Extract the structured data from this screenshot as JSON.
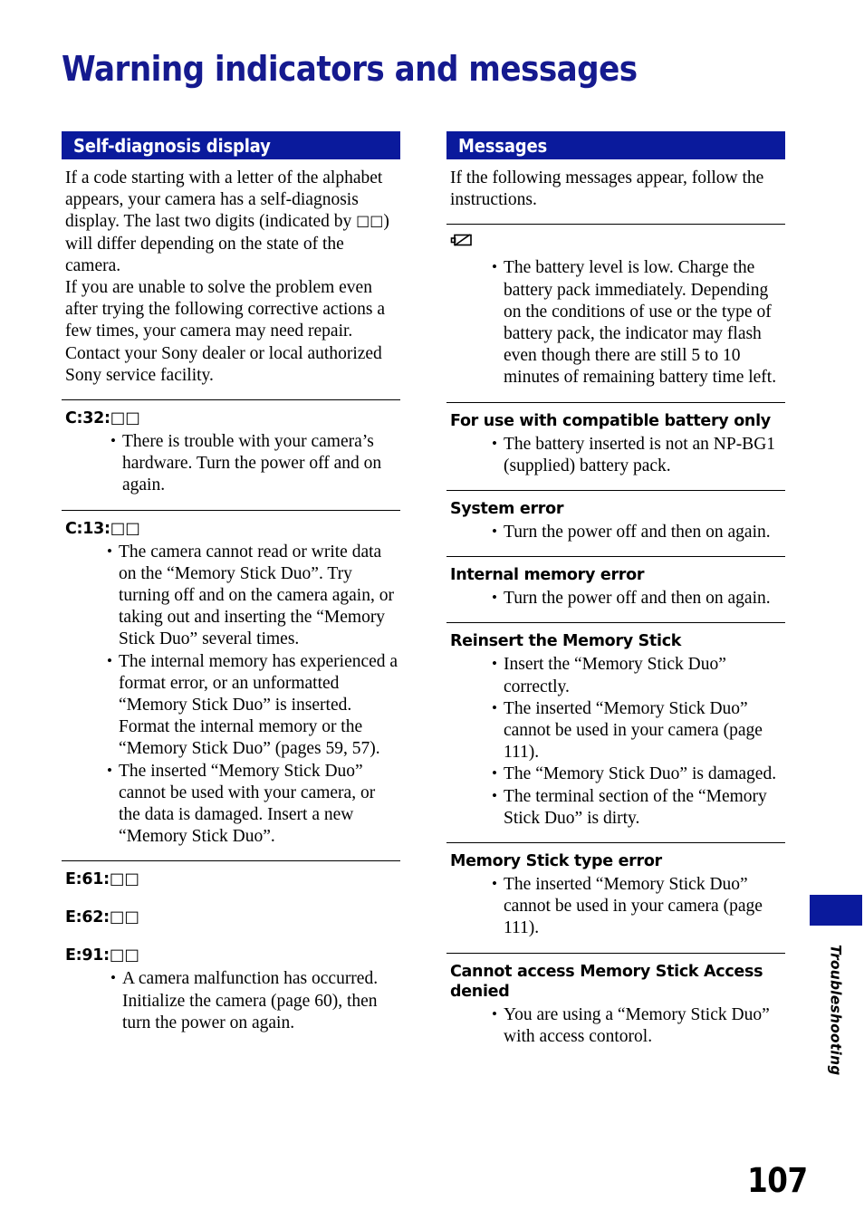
{
  "document": {
    "title": "Warning indicators and messages",
    "page_number": "107",
    "margin_tab_label": "Troubleshooting",
    "accent_color": "#0a1a9c",
    "title_color": "#151a8f"
  },
  "left_column": {
    "section_title": "Self-diagnosis display",
    "intro_paragraph_1_part1": "If a code starting with a letter of the alphabet appears, your camera has a self-diagnosis display. The last two digits (indicated by ",
    "intro_boxes": "□□",
    "intro_paragraph_1_part2": ") will differ depending on the state of the camera.",
    "intro_paragraph_2": "If you are unable to solve the problem even after trying the following corrective actions a few times, your camera may need repair. Contact your Sony dealer or local authorized Sony service facility.",
    "entries": [
      {
        "code": "C:32:",
        "boxes": "□□",
        "bullets": [
          "There is trouble with your camera’s hardware. Turn the power off and on again."
        ]
      },
      {
        "code": "C:13:",
        "boxes": "□□",
        "bullets": [
          "The camera cannot read or write data on the “Memory Stick Duo”. Try turning off and on the camera again, or taking out and inserting the “Memory Stick Duo” several times.",
          "The internal memory has experienced a format error, or an unformatted “Memory Stick Duo” is inserted. Format the internal memory or the “Memory Stick Duo” (pages 59, 57).",
          "The inserted “Memory Stick Duo” cannot be used with your camera, or the data is damaged. Insert a new “Memory Stick Duo”."
        ]
      },
      {
        "code": "E:61:",
        "boxes": "□□",
        "bullets": []
      },
      {
        "code": "E:62:",
        "boxes": "□□",
        "bullets": []
      },
      {
        "code": "E:91:",
        "boxes": "□□",
        "bullets": [
          "A camera malfunction has occurred. Initialize the camera (page 60), then turn the power on again."
        ]
      }
    ]
  },
  "right_column": {
    "section_title": "Messages",
    "intro_paragraph": "If the following messages appear, follow the instructions.",
    "entries": [
      {
        "icon": "low-battery-icon",
        "heading": "",
        "bullets": [
          "The battery level is low. Charge the battery pack immediately. Depending on the conditions of use or the type of battery pack, the indicator may flash even though there are still 5 to 10 minutes of remaining battery time left."
        ]
      },
      {
        "heading": "For use with compatible battery only",
        "bullets": [
          "The battery inserted is not an NP-BG1 (supplied) battery pack."
        ]
      },
      {
        "heading": "System error",
        "bullets": [
          "Turn the power off and then on again."
        ]
      },
      {
        "heading": "Internal memory error",
        "bullets": [
          "Turn the power off and then on again."
        ]
      },
      {
        "heading": "Reinsert the Memory Stick",
        "bullets": [
          "Insert the “Memory Stick Duo” correctly.",
          "The inserted “Memory Stick Duo” cannot be used in your camera (page 111).",
          "The “Memory Stick Duo” is damaged.",
          "The terminal section of the “Memory Stick Duo” is dirty."
        ]
      },
      {
        "heading": "Memory Stick type error",
        "bullets": [
          "The inserted “Memory Stick Duo” cannot be used in your camera (page 111)."
        ]
      },
      {
        "heading": "Cannot access Memory Stick Access denied",
        "bullets": [
          "You are using a “Memory Stick Duo” with access contorol."
        ]
      }
    ]
  }
}
